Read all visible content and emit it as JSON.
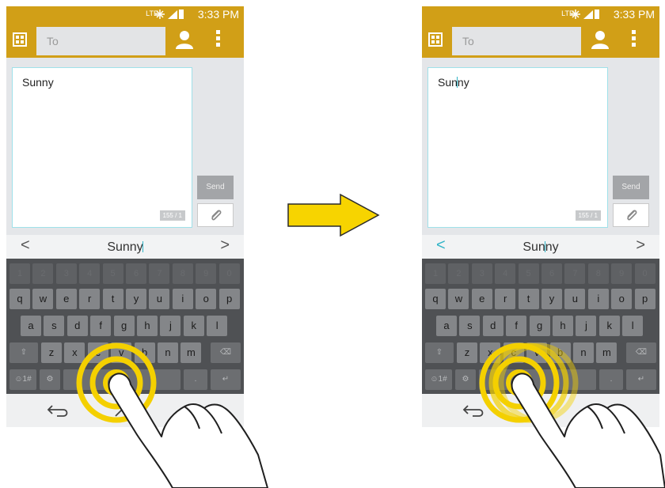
{
  "colors": {
    "accent": "#d19f17",
    "touch_ring": "#f4d000",
    "arrow_fill": "#f7d400"
  },
  "panels": [
    {
      "status": {
        "network": "LTE",
        "time": "3:33 PM"
      },
      "to_placeholder": "To",
      "message": "Sunny",
      "counter": "155 / 1",
      "send_label": "Send",
      "suggestion": "Sunny",
      "left_arrow": "<",
      "right_arrow": ">",
      "left_arrow_active": false
    },
    {
      "status": {
        "network": "LTE",
        "time": "3:33 PM"
      },
      "to_placeholder": "To",
      "message": "Sunny",
      "counter": "155 / 1",
      "send_label": "Send",
      "suggestion": "Sunny",
      "left_arrow": "<",
      "right_arrow": ">",
      "left_arrow_active": true
    }
  ],
  "keyboard": {
    "rows": [
      [
        "1",
        "2",
        "3",
        "4",
        "5",
        "6",
        "7",
        "8",
        "9",
        "0"
      ],
      [
        "q",
        "w",
        "e",
        "r",
        "t",
        "y",
        "u",
        "i",
        "o",
        "p"
      ],
      [
        "a",
        "s",
        "d",
        "f",
        "g",
        "h",
        "j",
        "k",
        "l"
      ],
      [
        "⇧",
        "z",
        "x",
        "c",
        "v",
        "b",
        "n",
        "m",
        "⌫"
      ],
      [
        "☺1#",
        "⚙",
        "",
        ".",
        "↵"
      ]
    ]
  },
  "icons": [
    "menu-icon",
    "contact-icon",
    "more-icon",
    "attach-icon",
    "back-icon",
    "home-icon",
    "direction-arrow-icon",
    "hand-icon",
    "touch-rings-icon"
  ]
}
